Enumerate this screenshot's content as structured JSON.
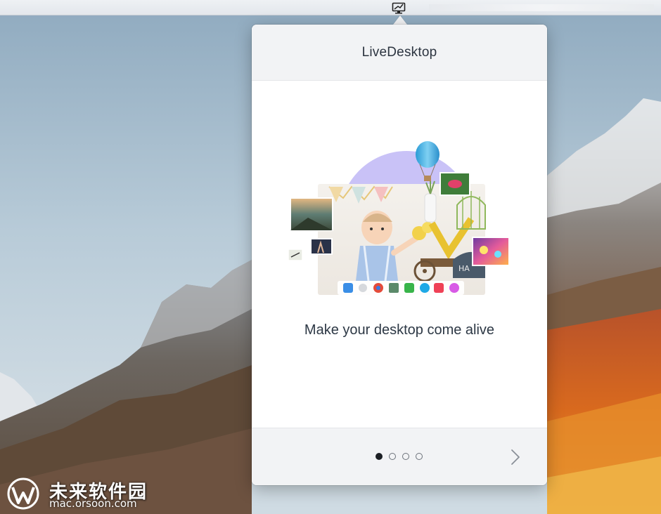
{
  "menubar": {
    "status_icon": "livedesktop-monitor-icon"
  },
  "popover": {
    "title": "LiveDesktop",
    "headline": "Make your desktop come alive",
    "illustration": {
      "icon": "desktop-collage-illustration",
      "dock_apps": [
        "finder",
        "launchpad",
        "chrome",
        "preview",
        "evernote",
        "skype",
        "pocket",
        "itunes"
      ]
    },
    "pagination": {
      "total": 4,
      "current": 1
    },
    "next_icon": "chevron-right-icon"
  },
  "watermark": {
    "text": "未来软件园",
    "url": "mac.orsoon.com"
  },
  "colors": {
    "popover_header": "#f2f3f5",
    "title_text": "#2c3440",
    "dot_active": "#1c1f24",
    "illustration_circle": "#c9c2f7"
  }
}
